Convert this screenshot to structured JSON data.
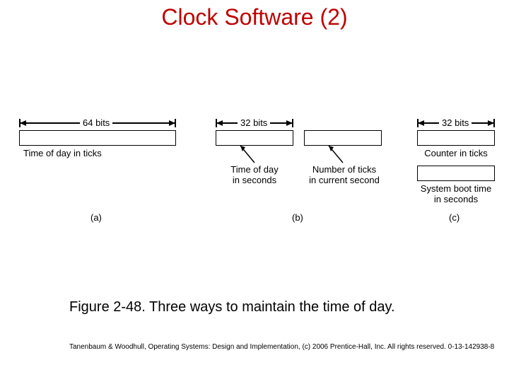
{
  "title": "Clock Software (2)",
  "caption": "Figure 2-48.  Three ways to maintain the time of day.",
  "footer": "Tanenbaum & Woodhull, Operating Systems: Design and Implementation, (c) 2006 Prentice-Hall, Inc. All rights reserved. 0-13-142938-8",
  "panel": {
    "a": {
      "width_label": "64 bits",
      "box_label": "Time of day in ticks",
      "tag": "(a)"
    },
    "b": {
      "width_label": "32 bits",
      "top_label": "Time of day\nin seconds",
      "bottom_label": "Number of ticks\nin current second",
      "tag": "(b)"
    },
    "c": {
      "width_label": "32 bits",
      "top_label": "Counter in ticks",
      "bottom_label": "System boot time\nin seconds",
      "tag": "(c)"
    }
  }
}
